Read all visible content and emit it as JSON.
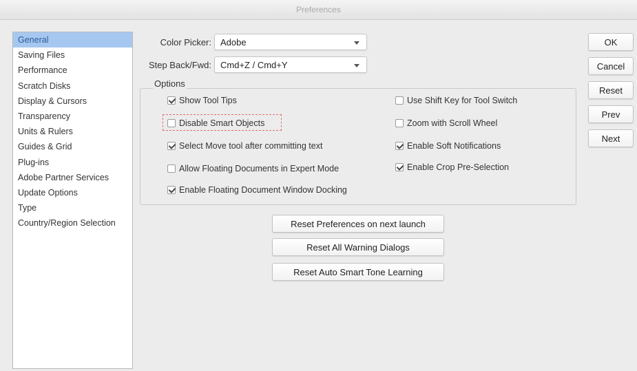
{
  "window": {
    "title": "Preferences"
  },
  "sidebar": {
    "items": [
      {
        "label": "General",
        "selected": true
      },
      {
        "label": "Saving Files"
      },
      {
        "label": "Performance"
      },
      {
        "label": "Scratch Disks"
      },
      {
        "label": "Display & Cursors"
      },
      {
        "label": "Transparency"
      },
      {
        "label": "Units & Rulers"
      },
      {
        "label": "Guides & Grid"
      },
      {
        "label": "Plug-ins"
      },
      {
        "label": "Adobe Partner Services"
      },
      {
        "label": "Update Options"
      },
      {
        "label": "Type"
      },
      {
        "label": "Country/Region Selection"
      }
    ]
  },
  "fields": {
    "color_picker": {
      "label": "Color Picker:",
      "value": "Adobe"
    },
    "step_back": {
      "label": "Step Back/Fwd:",
      "value": "Cmd+Z / Cmd+Y"
    }
  },
  "options": {
    "title": "Options",
    "show_tool_tips": {
      "label": "Show Tool Tips",
      "checked": true
    },
    "disable_smart_objects": {
      "label": "Disable Smart Objects",
      "checked": false
    },
    "select_move_tool": {
      "label": "Select Move tool after committing text",
      "checked": true
    },
    "allow_floating_docs": {
      "label": "Allow Floating Documents in Expert Mode",
      "checked": false
    },
    "enable_floating_docking": {
      "label": "Enable Floating Document Window Docking",
      "checked": true
    },
    "use_shift_key": {
      "label": "Use Shift Key for Tool Switch",
      "checked": false
    },
    "zoom_scroll_wheel": {
      "label": "Zoom with Scroll Wheel",
      "checked": false
    },
    "enable_soft_notifications": {
      "label": "Enable Soft Notifications",
      "checked": true
    },
    "enable_crop_preselection": {
      "label": "Enable Crop Pre-Selection",
      "checked": true
    }
  },
  "reset_buttons": {
    "preferences": "Reset Preferences on next launch",
    "warning_dialogs": "Reset All Warning Dialogs",
    "smart_tone": "Reset Auto Smart Tone Learning"
  },
  "actions": {
    "ok": "OK",
    "cancel": "Cancel",
    "reset": "Reset",
    "prev": "Prev",
    "next": "Next"
  },
  "colors": {
    "selection": "#a6c8f0",
    "highlight_border": "#e26b6b"
  }
}
